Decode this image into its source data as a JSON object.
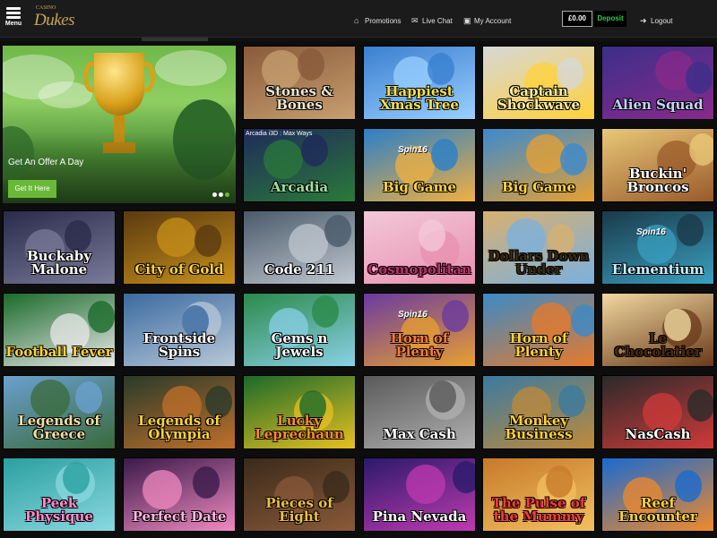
{
  "header": {
    "menu_label": "Menu",
    "logo_small": "CASINO",
    "logo_text": "Dukes",
    "nav": [
      {
        "label": "Promotions",
        "icon": "house-icon"
      },
      {
        "label": "Live Chat",
        "icon": "chat-icon"
      },
      {
        "label": "My Account",
        "icon": "account-icon"
      }
    ],
    "balance": "£0.00",
    "deposit_label": "Deposit",
    "logout_label": "Logout"
  },
  "banner": {
    "title": "Get An Offer A Day",
    "button_label": "Get It Here",
    "accent": "#6ab838"
  },
  "games": [
    {
      "title": "Stones & Bones",
      "caption": ""
    },
    {
      "title": "Happiest Xmas Tree",
      "caption": ""
    },
    {
      "title": "Captain Shockwave",
      "caption": ""
    },
    {
      "title": "Alien Squad",
      "caption": ""
    },
    {
      "title": "Arcadia",
      "caption": "Arcadia i3D : Max Ways"
    },
    {
      "title": "Big Game",
      "caption": "",
      "tag": "Spin16"
    },
    {
      "title": "Big Game",
      "caption": ""
    },
    {
      "title": "Buckin' Broncos",
      "caption": ""
    },
    {
      "title": "Buckaby Malone",
      "caption": ""
    },
    {
      "title": "City of Gold",
      "caption": ""
    },
    {
      "title": "Code 211",
      "caption": ""
    },
    {
      "title": "Cosmopolitan",
      "caption": ""
    },
    {
      "title": "Dollars Down Under",
      "caption": ""
    },
    {
      "title": "Elementium",
      "caption": "",
      "tag": "Spin16"
    },
    {
      "title": "Football Fever",
      "caption": ""
    },
    {
      "title": "Frontside Spins",
      "caption": ""
    },
    {
      "title": "Gems n Jewels",
      "caption": ""
    },
    {
      "title": "Horn of Plenty",
      "caption": "",
      "tag": "Spin16"
    },
    {
      "title": "Horn of Plenty",
      "caption": ""
    },
    {
      "title": "Le Chocolatier",
      "caption": ""
    },
    {
      "title": "Legends of Greece",
      "caption": ""
    },
    {
      "title": "Legends of Olympia",
      "caption": ""
    },
    {
      "title": "Lucky Leprechaun",
      "caption": ""
    },
    {
      "title": "Max Cash",
      "caption": ""
    },
    {
      "title": "Monkey Business",
      "caption": ""
    },
    {
      "title": "NasCash",
      "caption": ""
    },
    {
      "title": "Peek Physique",
      "caption": ""
    },
    {
      "title": "Perfect Date",
      "caption": ""
    },
    {
      "title": "Pieces of Eight",
      "caption": ""
    },
    {
      "title": "Pina Nevada",
      "caption": ""
    },
    {
      "title": "The Pulse of the Mummy",
      "caption": ""
    },
    {
      "title": "Reef Encounter",
      "caption": ""
    }
  ]
}
